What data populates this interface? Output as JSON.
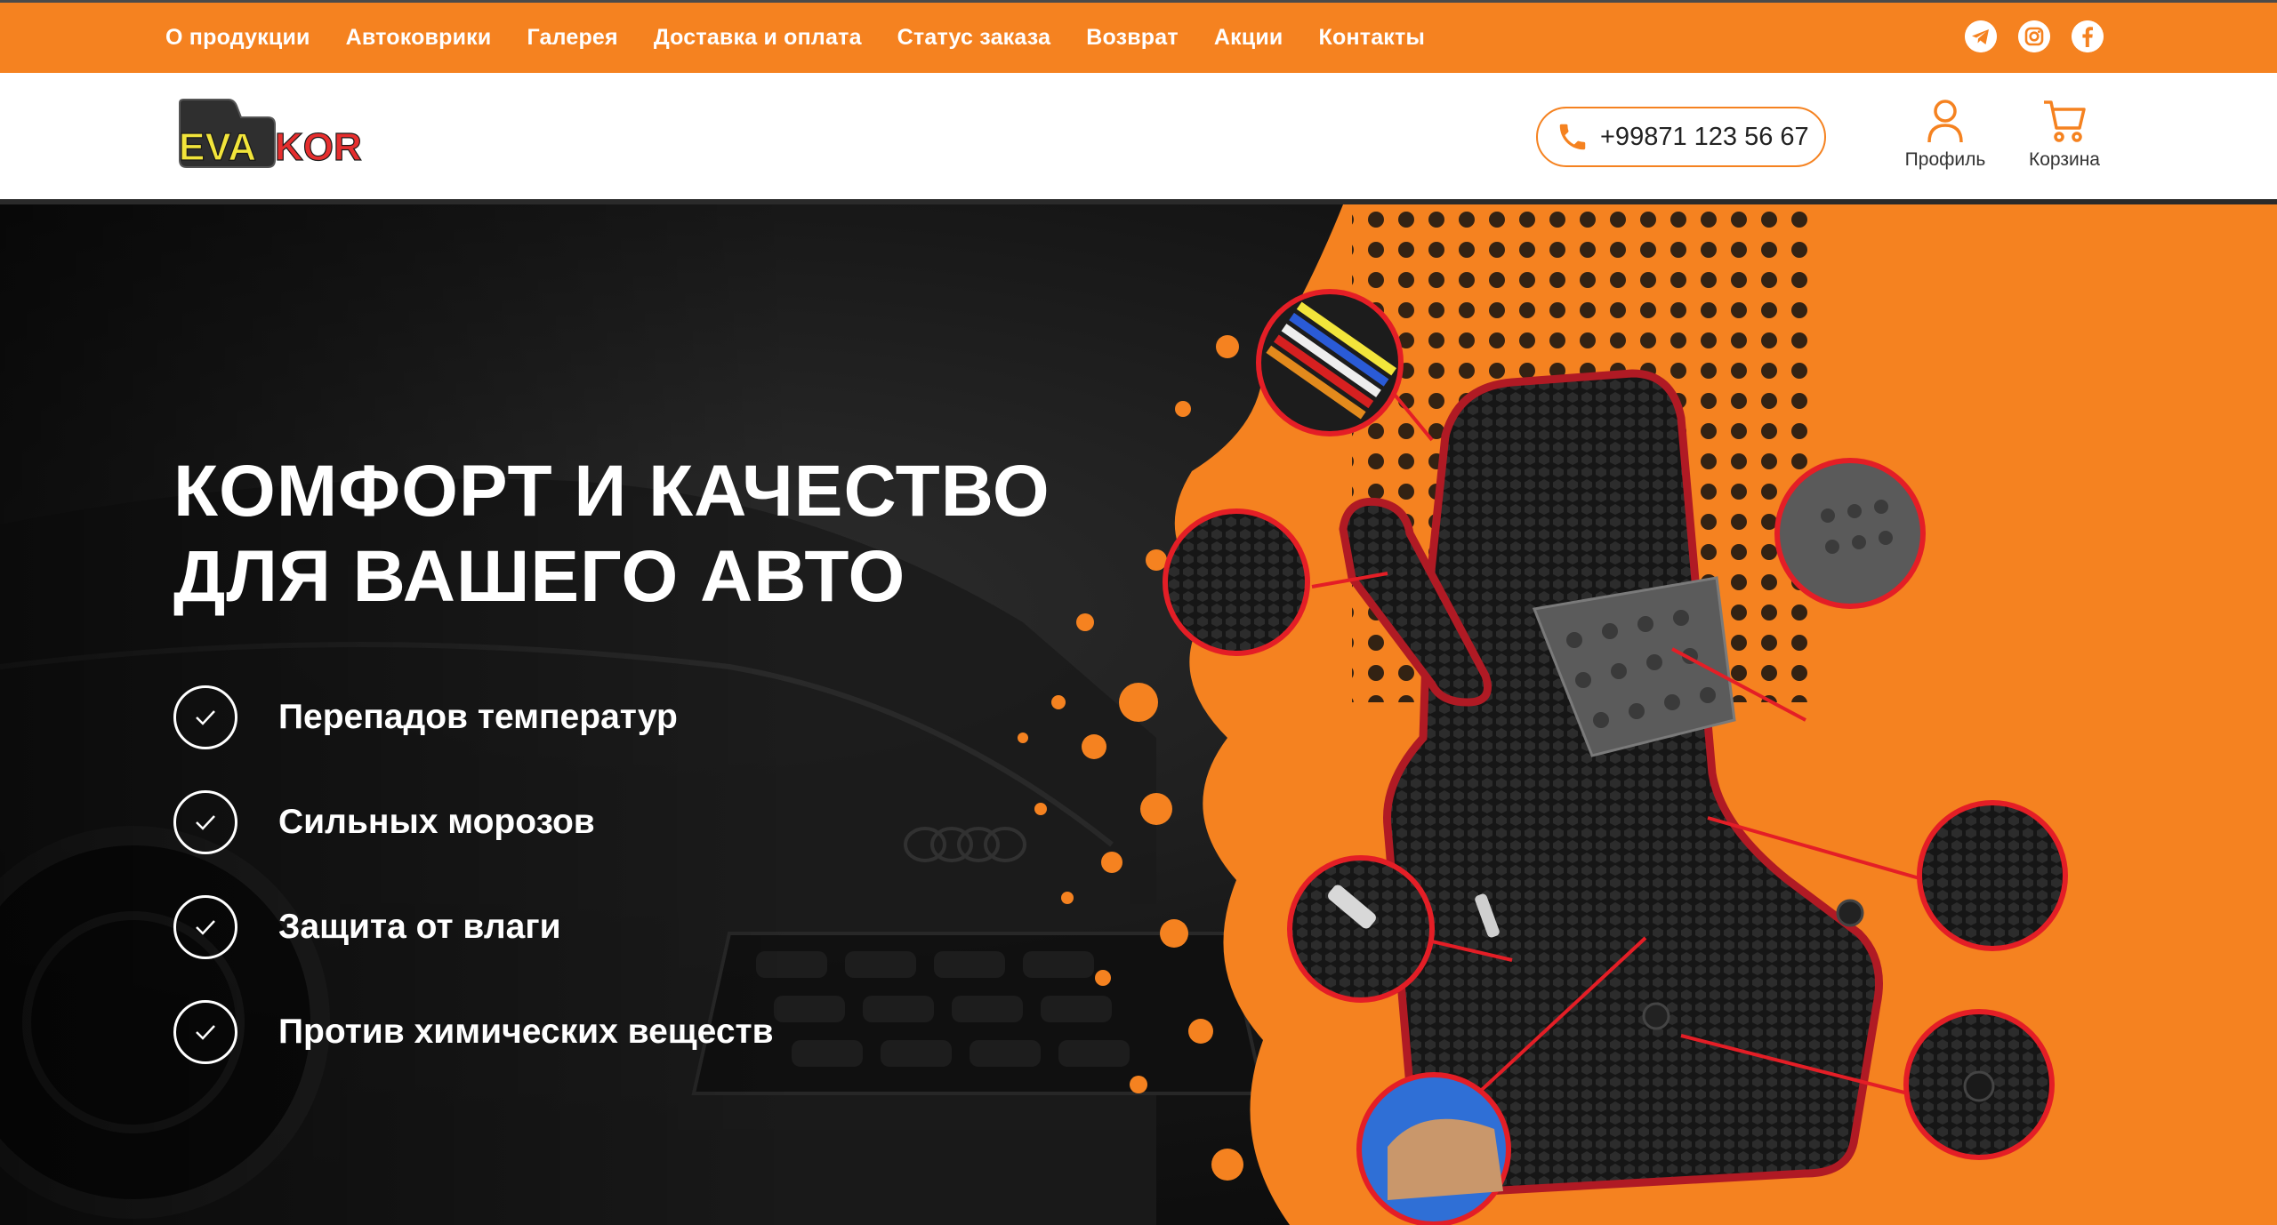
{
  "nav": {
    "items": [
      {
        "label": "О продукции"
      },
      {
        "label": "Автоковрики"
      },
      {
        "label": "Галерея"
      },
      {
        "label": "Доставка и оплата"
      },
      {
        "label": "Статус заказа"
      },
      {
        "label": "Возврат"
      },
      {
        "label": "Акции"
      },
      {
        "label": "Контакты"
      }
    ],
    "social_icons": [
      "telegram-icon",
      "instagram-icon",
      "facebook-icon"
    ]
  },
  "header": {
    "logo": {
      "part1": "EVA",
      "part2": "KOR"
    },
    "phone": "+99871 123 56 67",
    "profile_label": "Профиль",
    "cart_label": "Корзина"
  },
  "hero": {
    "title_line1": "КОМФОРТ И КАЧЕСТВО",
    "title_line2": "ДЛЯ ВАШЕГО АВТО",
    "features": [
      {
        "label": "Перепадов температур"
      },
      {
        "label": "Сильных морозов"
      },
      {
        "label": "Защита от влаги"
      },
      {
        "label": "Против химических веществ"
      }
    ]
  },
  "colors": {
    "accent": "#f58220",
    "dark": "#111111",
    "white": "#ffffff",
    "mat_edge": "#b01a24"
  }
}
